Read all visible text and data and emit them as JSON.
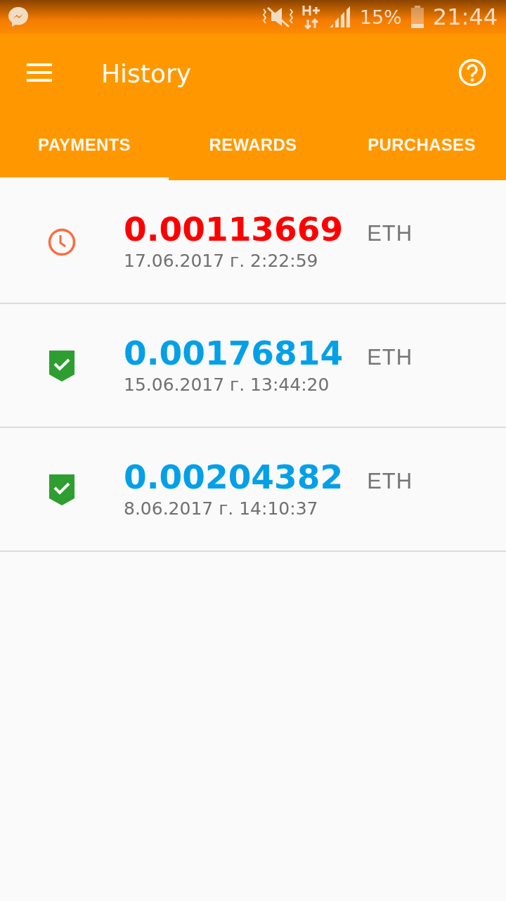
{
  "status_bar": {
    "battery": "15%",
    "time": "21:44"
  },
  "toolbar": {
    "title": "History"
  },
  "tabs": [
    {
      "label": "PAYMENTS",
      "selected": true
    },
    {
      "label": "REWARDS",
      "selected": false
    },
    {
      "label": "PURCHASES",
      "selected": false
    }
  ],
  "payments": [
    {
      "kind": "pending",
      "amount": "0.00113669",
      "currency": "ETH",
      "date": "17.06.2017 г. 2:22:59"
    },
    {
      "kind": "confirmed",
      "amount": "0.00176814",
      "currency": "ETH",
      "date": "15.06.2017 г. 13:44:20"
    },
    {
      "kind": "confirmed",
      "amount": "0.00204382",
      "currency": "ETH",
      "date": "8.06.2017 г. 14:10:37"
    }
  ]
}
